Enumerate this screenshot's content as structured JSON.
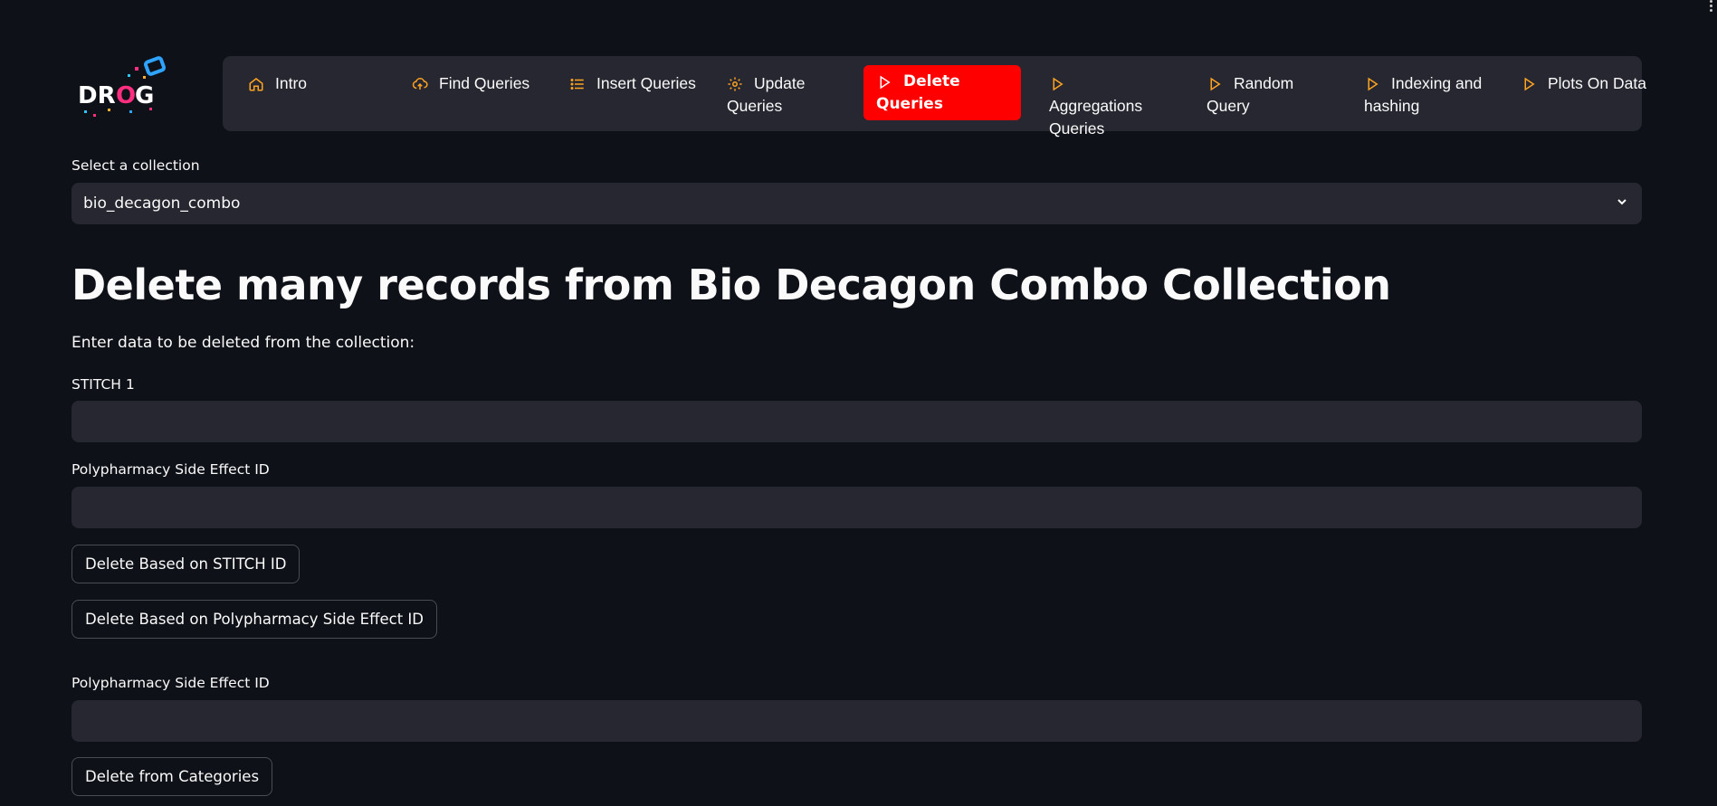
{
  "nav": {
    "items": [
      {
        "label": "Intro",
        "icon": "house-icon"
      },
      {
        "label": "Find Queries",
        "icon": "cloud-upload-icon"
      },
      {
        "label": "Insert Queries",
        "icon": "list-icon"
      },
      {
        "label": "Update Queries",
        "icon": "gear-icon"
      },
      {
        "label": "Delete Queries",
        "icon": "play-icon"
      },
      {
        "label": "Aggregations Queries",
        "icon": "play-icon"
      },
      {
        "label": "Random Query",
        "icon": "play-icon"
      },
      {
        "label": "Indexing and hashing",
        "icon": "play-icon"
      },
      {
        "label": "Plots On Data",
        "icon": "play-icon"
      }
    ],
    "active_color": "#ff0000",
    "icon_color": "#ffa421"
  },
  "logo": {
    "text": "DROG"
  },
  "collection": {
    "label": "Select a collection",
    "value": "bio_decagon_combo"
  },
  "main": {
    "title": "Delete many records from Bio Decagon Combo Collection",
    "intro": "Enter data to be deleted from the collection:",
    "field1_label": "STITCH 1",
    "field2_label": "Polypharmacy Side Effect ID",
    "btn_stitch": "Delete Based on STITCH ID",
    "btn_poly": "Delete Based on Polypharmacy Side Effect ID",
    "field3_label": "Polypharmacy Side Effect ID",
    "btn_categories": "Delete from Categories"
  }
}
